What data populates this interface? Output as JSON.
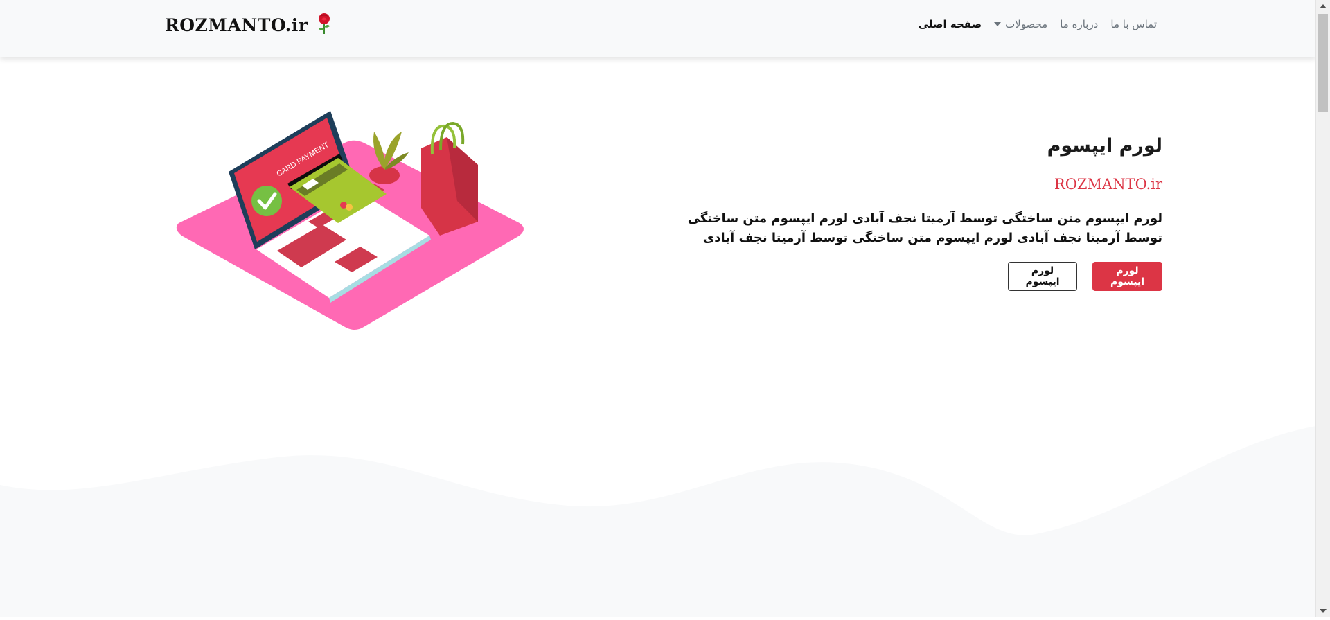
{
  "navbar": {
    "brand": "ROZMANTO.ir",
    "brand_icon": "rose-icon",
    "items": [
      {
        "label": "صفحه اصلی",
        "active": true
      },
      {
        "label": "محصولات",
        "dropdown": true
      },
      {
        "label": "درباره ما"
      },
      {
        "label": "تماس با ما"
      }
    ]
  },
  "hero": {
    "title": "لورم ایپسوم",
    "subtitle": "ROZMANTO.ir",
    "description": "لورم ایپسوم متن ساختگی توسط آرمیتا نجف آبادی لورم ایپسوم متن ساختگی توسط آرمیتا نجف آبادی لورم ایپسوم متن ساختگی توسط آرمیتا نجف آبادی",
    "primary_button": "لورم ایپسوم",
    "secondary_button": "لورم ایپسوم",
    "illustration": {
      "screen_text": "CARD PAYMENT"
    }
  },
  "colors": {
    "accent": "#dc3545",
    "navbar_bg": "#f8f9fa",
    "wave": "#f8f9fa",
    "illustration_pink": "#ff69b4"
  }
}
